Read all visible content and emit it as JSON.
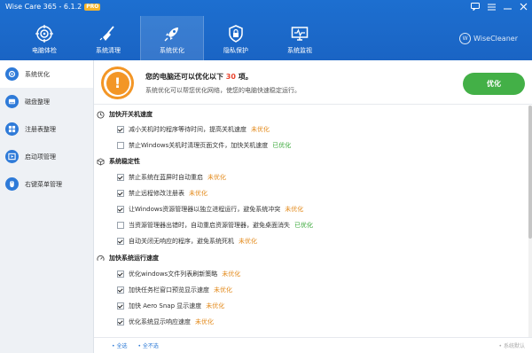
{
  "window": {
    "title": "Wise Care 365 - 6.1.2",
    "edition_badge": "PRO"
  },
  "nav": {
    "tabs": [
      {
        "label": "电脑体检",
        "icon": "target-icon"
      },
      {
        "label": "系统清理",
        "icon": "broom-icon"
      },
      {
        "label": "系统优化",
        "icon": "rocket-icon",
        "active": true
      },
      {
        "label": "隐私保护",
        "icon": "shield-lock-icon"
      },
      {
        "label": "系统监视",
        "icon": "monitor-icon"
      }
    ],
    "brand": "WiseCleaner",
    "brand_logo": "W"
  },
  "sidebar": {
    "items": [
      {
        "label": "系统优化",
        "icon": "gear-icon",
        "active": true
      },
      {
        "label": "磁盘整理",
        "icon": "disk-icon"
      },
      {
        "label": "注册表整理",
        "icon": "registry-icon"
      },
      {
        "label": "启动项管理",
        "icon": "startup-icon"
      },
      {
        "label": "右键菜单管理",
        "icon": "mouse-icon"
      }
    ]
  },
  "summary": {
    "title_prefix": "您的电脑还可以优化以下",
    "count": "30",
    "title_suffix": "项。",
    "subtitle": "系统优化可以帮您优化网络，使您的电脑快速稳定运行。",
    "warn_glyph": "!",
    "optimize_button": "优化"
  },
  "groups": [
    {
      "title": "加快开关机速度",
      "icon": "clock-icon",
      "items": [
        {
          "label": "减小关机时的程序等待时间，提高关机速度",
          "status": "未优化",
          "checked": true
        },
        {
          "label": "禁止Windows关机时清理页面文件，加快关机速度",
          "status": "已优化",
          "checked": false
        }
      ]
    },
    {
      "title": "系统稳定性",
      "icon": "cube-icon",
      "items": [
        {
          "label": "禁止系统在蓝屏时自动重启",
          "status": "未优化",
          "checked": true
        },
        {
          "label": "禁止远程修改注册表",
          "status": "未优化",
          "checked": true
        },
        {
          "label": "让Windows资源管理器以独立进程运行，避免系统冲突",
          "status": "未优化",
          "checked": true
        },
        {
          "label": "当资源管理器出错时，自动重启资源管理器，避免桌面消失",
          "status": "已优化",
          "checked": false
        },
        {
          "label": "自动关闭无响应的程序，避免系统死机",
          "status": "未优化",
          "checked": true
        }
      ]
    },
    {
      "title": "加快系统运行速度",
      "icon": "speedometer-icon",
      "items": [
        {
          "label": "优化windows文件列表刷新策略",
          "status": "未优化",
          "checked": true
        },
        {
          "label": "加快任务栏窗口预览显示速度",
          "status": "未优化",
          "checked": true
        },
        {
          "label": "加快 Aero Snap 显示速度",
          "status": "未优化",
          "checked": true
        },
        {
          "label": "优化系统显示响应速度",
          "status": "未优化",
          "checked": true
        }
      ]
    }
  ],
  "footer": {
    "select_all": "• 全选",
    "deselect_all": "• 全不选",
    "restore": "• 系统默认"
  },
  "colors": {
    "header_blue": "#1d6fd0",
    "accent_green": "#43b047",
    "warn_orange": "#f39626",
    "status_unoptimized": "#e38a1b",
    "status_optimized": "#3aa83a",
    "count_red": "#e9442e"
  }
}
